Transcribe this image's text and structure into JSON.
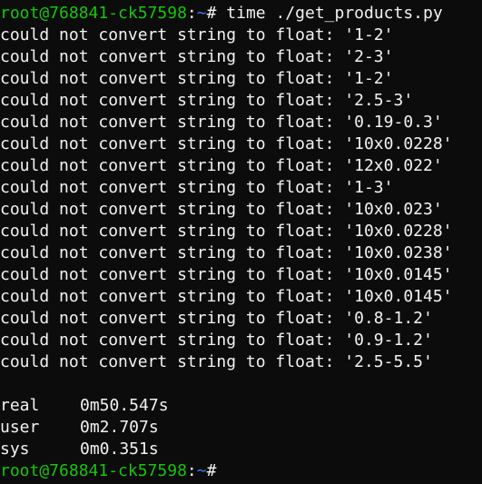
{
  "terminal": {
    "prompt_user_host": "root@768841-ck57598",
    "prompt_sep": ":",
    "prompt_path": "~",
    "prompt_symbol": "# ",
    "command": "time ./get_products.py",
    "errors": [
      "could not convert string to float: '1-2'",
      "could not convert string to float: '2-3'",
      "could not convert string to float: '1-2'",
      "could not convert string to float: '2.5-3'",
      "could not convert string to float: '0.19-0.3'",
      "could not convert string to float: '10x0.0228'",
      "could not convert string to float: '12x0.022'",
      "could not convert string to float: '1-3'",
      "could not convert string to float: '10x0.023'",
      "could not convert string to float: '10x0.0228'",
      "could not convert string to float: '10x0.0238'",
      "could not convert string to float: '10x0.0145'",
      "could not convert string to float: '10x0.0145'",
      "could not convert string to float: '0.8-1.2'",
      "could not convert string to float: '0.9-1.2'",
      "could not convert string to float: '2.5-5.5'"
    ],
    "timing": {
      "real_label": "real",
      "real_value": "0m50.547s",
      "user_label": "user",
      "user_value": "0m2.707s",
      "sys_label": "sys",
      "sys_value": "0m0.351s"
    }
  }
}
